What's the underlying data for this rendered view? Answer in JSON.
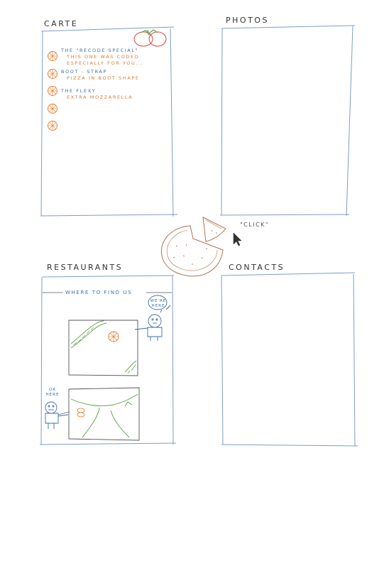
{
  "panels": {
    "carte": {
      "heading": "Carte"
    },
    "photos": {
      "heading": "Photos"
    },
    "restaurants": {
      "heading": "Restaurants"
    },
    "contacts": {
      "heading": "Contacts"
    }
  },
  "menu_items": [
    {
      "title": "The \"Recode Special\"",
      "desc1": "This one was coded",
      "desc2": "especially for you..."
    },
    {
      "title": "Boot - Strap",
      "desc1": "Pizza in Boot shape",
      "desc2": ""
    },
    {
      "title": "The Flexy",
      "desc1": "Extra mozzarella",
      "desc2": ""
    },
    {
      "title": "",
      "desc1": "",
      "desc2": ""
    },
    {
      "title": "",
      "desc1": "",
      "desc2": ""
    }
  ],
  "center": {
    "click_label": "\"Click\""
  },
  "restaurants": {
    "where_label": "Where to find us",
    "bubble_top": "We're here",
    "bubble_bottom": "Or here"
  },
  "colors": {
    "panel_border": "#7f9cc7",
    "blue_text": "#3a6ea8",
    "orange": "#e07a2a",
    "green": "#5aa046",
    "red": "#e04a3a",
    "pizza": "#b07050"
  }
}
